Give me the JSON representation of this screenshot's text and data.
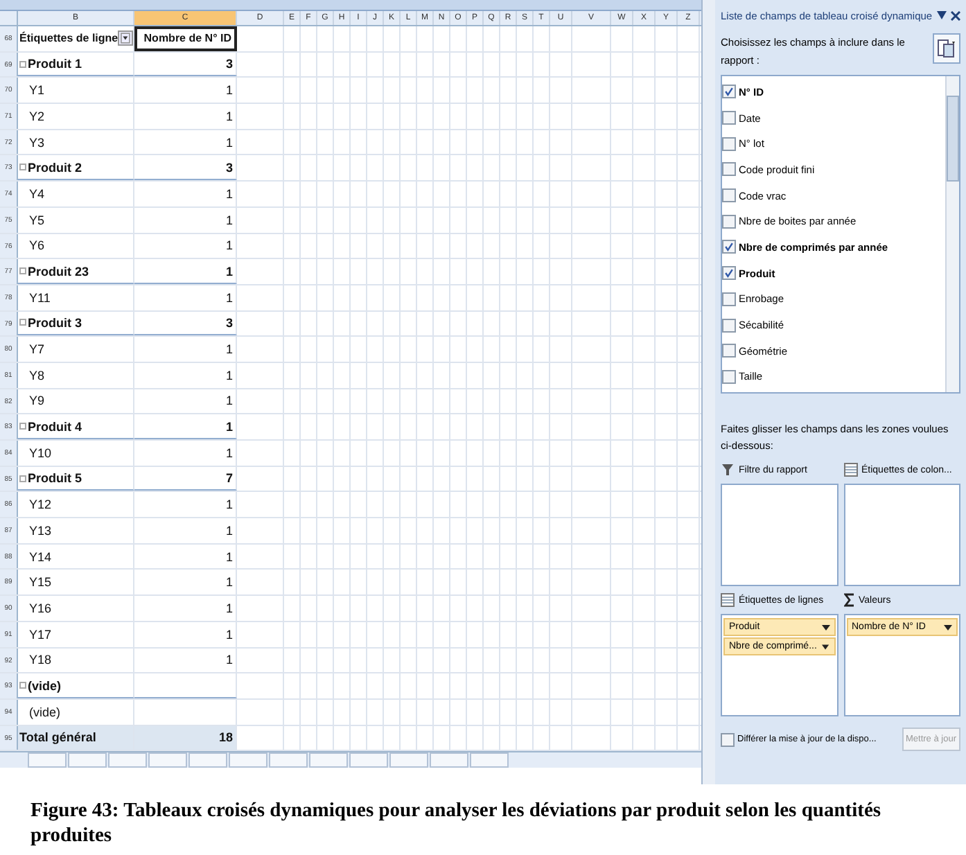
{
  "sheet": {
    "columns": [
      {
        "label": "B",
        "selected": false
      },
      {
        "label": "C",
        "selected": true
      },
      {
        "label": "D",
        "selected": false
      },
      {
        "label": "E",
        "selected": false
      },
      {
        "label": "F",
        "selected": false
      },
      {
        "label": "G",
        "selected": false
      },
      {
        "label": "H",
        "selected": false
      },
      {
        "label": "I",
        "selected": false
      },
      {
        "label": "J",
        "selected": false
      },
      {
        "label": "K",
        "selected": false
      },
      {
        "label": "L",
        "selected": false
      },
      {
        "label": "M",
        "selected": false
      },
      {
        "label": "N",
        "selected": false
      },
      {
        "label": "O",
        "selected": false
      },
      {
        "label": "P",
        "selected": false
      },
      {
        "label": "Q",
        "selected": false
      },
      {
        "label": "R",
        "selected": false
      },
      {
        "label": "S",
        "selected": false
      },
      {
        "label": "T",
        "selected": false
      },
      {
        "label": "U",
        "selected": false
      },
      {
        "label": "V",
        "selected": false
      },
      {
        "label": "W",
        "selected": false
      },
      {
        "label": "X",
        "selected": false
      },
      {
        "label": "Y",
        "selected": false
      },
      {
        "label": "Z",
        "selected": false
      }
    ],
    "rows": [
      {
        "number": "68",
        "kind": "header",
        "label": "Étiquettes de ligne",
        "value": "Nombre de N° ID"
      },
      {
        "number": "69",
        "kind": "group",
        "label": "Produit 1",
        "value": "3"
      },
      {
        "number": "70",
        "kind": "item",
        "label": "Y1",
        "value": "1"
      },
      {
        "number": "71",
        "kind": "item",
        "label": "Y2",
        "value": "1"
      },
      {
        "number": "72",
        "kind": "item",
        "label": "Y3",
        "value": "1"
      },
      {
        "number": "73",
        "kind": "group",
        "label": "Produit 2",
        "value": "3"
      },
      {
        "number": "74",
        "kind": "item",
        "label": "Y4",
        "value": "1"
      },
      {
        "number": "75",
        "kind": "item",
        "label": "Y5",
        "value": "1"
      },
      {
        "number": "76",
        "kind": "item",
        "label": "Y6",
        "value": "1"
      },
      {
        "number": "77",
        "kind": "group",
        "label": "Produit 23",
        "value": "1"
      },
      {
        "number": "78",
        "kind": "item",
        "label": "Y11",
        "value": "1"
      },
      {
        "number": "79",
        "kind": "group",
        "label": "Produit 3",
        "value": "3"
      },
      {
        "number": "80",
        "kind": "item",
        "label": "Y7",
        "value": "1"
      },
      {
        "number": "81",
        "kind": "item",
        "label": "Y8",
        "value": "1"
      },
      {
        "number": "82",
        "kind": "item",
        "label": "Y9",
        "value": "1"
      },
      {
        "number": "83",
        "kind": "group",
        "label": "Produit 4",
        "value": "1"
      },
      {
        "number": "84",
        "kind": "item",
        "label": "Y10",
        "value": "1"
      },
      {
        "number": "85",
        "kind": "group",
        "label": "Produit 5",
        "value": "7"
      },
      {
        "number": "86",
        "kind": "item",
        "label": "Y12",
        "value": "1"
      },
      {
        "number": "87",
        "kind": "item",
        "label": "Y13",
        "value": "1"
      },
      {
        "number": "88",
        "kind": "item",
        "label": "Y14",
        "value": "1"
      },
      {
        "number": "89",
        "kind": "item",
        "label": "Y15",
        "value": "1"
      },
      {
        "number": "90",
        "kind": "item",
        "label": "Y16",
        "value": "1"
      },
      {
        "number": "91",
        "kind": "item",
        "label": "Y17",
        "value": "1"
      },
      {
        "number": "92",
        "kind": "item",
        "label": "Y18",
        "value": "1"
      },
      {
        "number": "93",
        "kind": "group",
        "label": "(vide)"
      },
      {
        "number": "94",
        "kind": "item",
        "label": "(vide)"
      },
      {
        "number": "95",
        "kind": "total",
        "label": "Total général",
        "value": "18"
      }
    ]
  },
  "field_list": {
    "title": "Liste de champs de tableau croisé dynamique",
    "instruction": "Choisissez les champs à inclure dans le rapport :",
    "fields": [
      {
        "label": "N° ID",
        "checked": true
      },
      {
        "label": "Date",
        "checked": false
      },
      {
        "label": "N° lot",
        "checked": false
      },
      {
        "label": "Code produit fini",
        "checked": false
      },
      {
        "label": "Code vrac",
        "checked": false
      },
      {
        "label": "Nbre de boites par année",
        "checked": false
      },
      {
        "label": "Nbre de comprimés par année",
        "checked": true
      },
      {
        "label": "Produit",
        "checked": true
      },
      {
        "label": "Enrobage",
        "checked": false
      },
      {
        "label": "Sécabilité",
        "checked": false
      },
      {
        "label": "Géométrie",
        "checked": false
      },
      {
        "label": "Taille",
        "checked": false
      }
    ],
    "drag_hint": "Faites glisser les champs dans les zones voulues ci-dessous:",
    "areas": [
      {
        "kind": "filter",
        "label": "Filtre du rapport"
      },
      {
        "kind": "columns",
        "label": "Étiquettes de colon..."
      },
      {
        "kind": "rows",
        "label": "Étiquettes de lignes",
        "items": [
          "Produit",
          "Nbre de comprimé..."
        ]
      },
      {
        "kind": "values",
        "label": "Valeurs",
        "items": [
          "Nombre de N° ID"
        ]
      }
    ],
    "defer": {
      "label": "Différer la mise à jour de la dispo...",
      "checked": false
    },
    "update_button": {
      "label": "Mettre à jour",
      "disabled": true
    }
  },
  "caption": "Figure 43: Tableaux croisés dynamiques pour analyser les déviations par produit selon les quantités produites"
}
